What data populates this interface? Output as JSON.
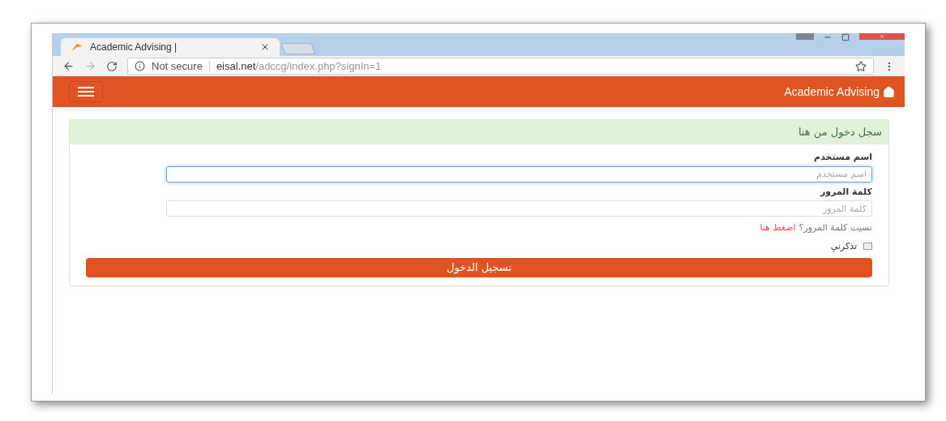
{
  "browser": {
    "tabs": [
      {
        "title": "Academic Advising |",
        "selected": true
      }
    ],
    "address": {
      "security": "Not secure",
      "domain": "eisal.net",
      "path": "/adccg/index.php?signIn=1"
    }
  },
  "navbar": {
    "brand": "Academic Advising"
  },
  "panel": {
    "heading": "سجل دخول من هنا",
    "fields": [
      {
        "label": "اسم مستخدم",
        "placeholder": "اسم مستخدم",
        "focused": true
      },
      {
        "label": "كلمة المرور",
        "placeholder": "كلمة المرور",
        "focused": false
      }
    ],
    "forgot": {
      "text": "نسيت كلمة المرور؟",
      "link": "اضغط هنا"
    },
    "remember": {
      "label": "تذكرني",
      "checked": false
    },
    "submit": "تسجيل الدخول"
  }
}
